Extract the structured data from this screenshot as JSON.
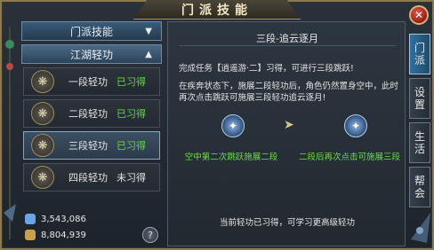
{
  "window": {
    "title": "门派技能"
  },
  "close_icon": "✕",
  "categories": {
    "main": {
      "label": "门派技能",
      "arrow": "▼"
    },
    "sub": {
      "label": "江湖轻功",
      "arrow": "▲"
    }
  },
  "skills": [
    {
      "name": "一段轻功",
      "status": "已习得",
      "status_color": "#5fdc3e",
      "icon": "❋"
    },
    {
      "name": "二段轻功",
      "status": "已习得",
      "status_color": "#5fdc3e",
      "icon": "❋"
    },
    {
      "name": "三段轻功",
      "status": "已习得",
      "status_color": "#5fdc3e",
      "icon": "❋"
    },
    {
      "name": "四段轻功",
      "status": "未习得",
      "status_color": "#e6e6e6",
      "icon": "❋"
    }
  ],
  "resources": [
    {
      "value": "3,543,086",
      "color": "#6ba3e8"
    },
    {
      "value": "8,804,939",
      "color": "#c9a14a"
    }
  ],
  "help_label": "?",
  "detail": {
    "title": "三段-追云逐月",
    "line1": "完成任务【逍遥游·二】习得，可进行三段跳跃!",
    "line2": "在疾奔状态下，施展二段轻功后，角色仍然置身空中，此时再次点击跳跃可施展三段轻功追云逐月!",
    "caption_left": "空中第二次跳跃施展二段",
    "caption_right": "二段后再次点击可施展三段",
    "arrow": "➤",
    "footer": "当前轻功已习得，可学习更高级轻功"
  },
  "tabs": [
    {
      "label": [
        "门",
        "派"
      ]
    },
    {
      "label": [
        "设",
        "置"
      ]
    },
    {
      "label": [
        "生",
        "活"
      ]
    },
    {
      "label": [
        "帮",
        "会"
      ]
    }
  ],
  "colors": {
    "active_tab": "#2f6f9c",
    "learned": "#5fdc3e",
    "border_gold": "#8a7a52"
  }
}
